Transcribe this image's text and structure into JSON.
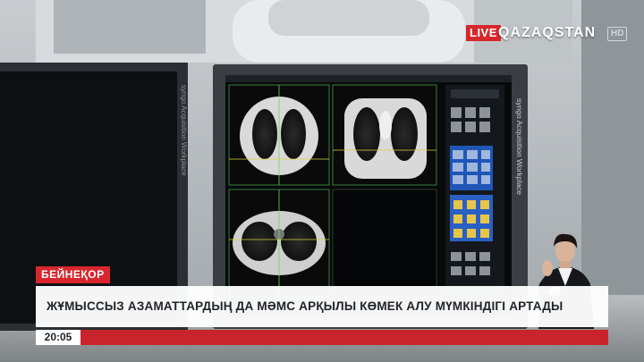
{
  "broadcast": {
    "live_label": "LIVE",
    "channel_name": "QAZAQSTAN",
    "hd_label": "HD",
    "location": "БЕЙНЕҚОР",
    "headline": "ЖҰМЫССЫЗ АЗАМАТТАРДЫҢ ДА МӘМС АРҚЫЛЫ КӨМЕК АЛУ МҮМКІНДІГІ АРТАДЫ",
    "clock": "20:05"
  },
  "monitor": {
    "vertical_label": "syngo Acquisition Workplace"
  },
  "colors": {
    "live_red": "#d7262c",
    "ticker_red": "#c9242b",
    "headline_bg": "#ffffff"
  }
}
